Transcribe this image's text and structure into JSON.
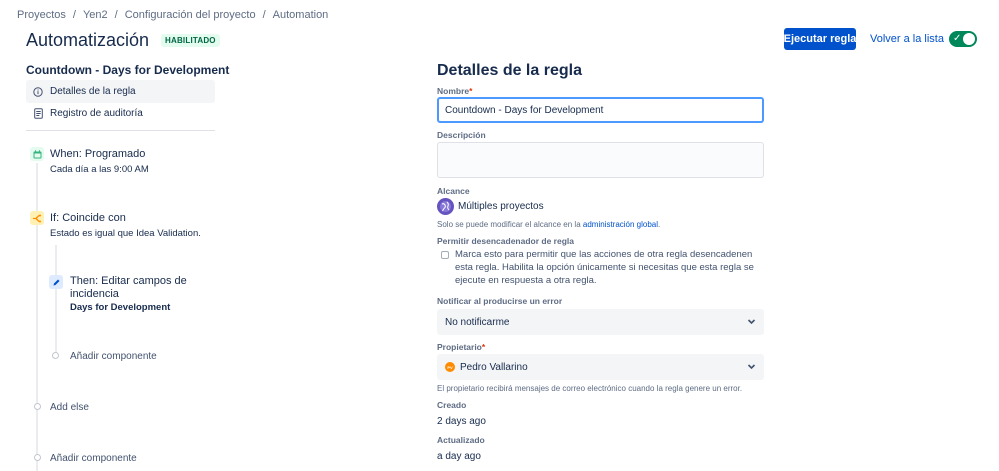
{
  "breadcrumb": [
    "Proyectos",
    "Yen2",
    "Configuración del proyecto",
    "Automation"
  ],
  "breadcrumb_separator": "/",
  "header": {
    "title": "Automatización",
    "status_badge": "HABILITADO",
    "run_button": "Ejecutar regla",
    "back_link": "Volver a la lista",
    "toggle_checked": true
  },
  "sidebar": {
    "rule_name": "Countdown - Days for Development",
    "items": [
      {
        "label": "Detalles de la regla",
        "icon": "info-icon",
        "active": true
      },
      {
        "label": "Registro de auditoría",
        "icon": "document-icon",
        "active": false
      }
    ]
  },
  "components": {
    "trigger": {
      "title": "When: Programado",
      "subtitle": "Cada día a las 9:00 AM",
      "icon": "calendar-icon",
      "color": "#36b37e"
    },
    "condition": {
      "title": "If: Coincide con",
      "subtitle": "Estado es igual que Idea Validation.",
      "icon": "branch-icon",
      "color": "#ffab00"
    },
    "action": {
      "title_line1": "Then: Editar campos de",
      "title_line2": "incidencia",
      "subtitle": "Days for Development",
      "icon": "pencil-icon",
      "color": "#0065ff"
    },
    "add_component_inner": "Añadir componente",
    "add_else": "Add else",
    "add_component_outer": "Añadir componente"
  },
  "details": {
    "title": "Detalles de la regla",
    "name_label": "Nombre",
    "name_value": "Countdown - Days for Development",
    "description_label": "Descripción",
    "scope_label": "Alcance",
    "scope_value": "Múltiples proyectos",
    "scope_helper_prefix": "Solo se puede modificar el alcance en la ",
    "scope_helper_link": "administración global",
    "scope_helper_suffix": ".",
    "allow_trigger_label": "Permitir desencadenador de regla",
    "allow_trigger_text": "Marca esto para permitir que las acciones de otra regla desencadenen esta regla. Habilita la opción únicamente si necesitas que esta regla se ejecute en respuesta a otra regla.",
    "notify_label": "Notificar al producirse un error",
    "notify_value": "No notificarme",
    "owner_label": "Propietario",
    "owner_initials": "PV",
    "owner_value": "Pedro Vallarino",
    "owner_helper": "El propietario recibirá mensajes de correo electrónico cuando la regla genere un error.",
    "created_label": "Creado",
    "created_value": "2 days ago",
    "updated_label": "Actualizado",
    "updated_value": "a day ago",
    "required_mark": "*"
  },
  "colors": {
    "primary": "#0052cc",
    "success": "#00875a",
    "focus": "#4c9aff"
  }
}
